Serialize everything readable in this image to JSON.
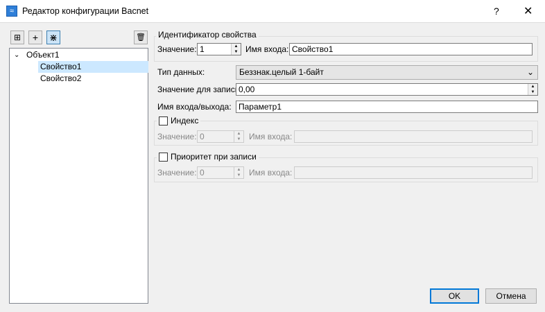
{
  "window": {
    "title": "Редактор конфигурации Bacnet",
    "help": "?",
    "close": "✕"
  },
  "toolbar": {
    "add_folder": "⊞",
    "add": "+",
    "collapse": "⋇",
    "delete": "🗑"
  },
  "tree": {
    "root": "Объект1",
    "children": [
      {
        "label": "Свойство1",
        "selected": true
      },
      {
        "label": "Свойство2",
        "selected": false
      }
    ]
  },
  "identifier": {
    "legend": "Идентификатор свойства",
    "value_label": "Значение:",
    "value": "1",
    "input_label": "Имя входа:",
    "input_value": "Свойство1"
  },
  "data_type": {
    "label": "Тип данных:",
    "value": "Беззнак.целый 1-байт"
  },
  "write_value": {
    "label": "Значение для записи:",
    "value": "0,00"
  },
  "io_name": {
    "label": "Имя входа/выхода:",
    "value": "Параметр1"
  },
  "index": {
    "label": "Индекс",
    "checked": false,
    "value_label": "Значение:",
    "value": "0",
    "input_label": "Имя входа:",
    "input_value": ""
  },
  "priority": {
    "label": "Приоритет при записи",
    "checked": false,
    "value_label": "Значение:",
    "value": "0",
    "input_label": "Имя входа:",
    "input_value": ""
  },
  "buttons": {
    "ok": "OK",
    "cancel": "Отмена"
  },
  "colors": {
    "accent": "#0078d7",
    "selection": "#cce8ff"
  }
}
